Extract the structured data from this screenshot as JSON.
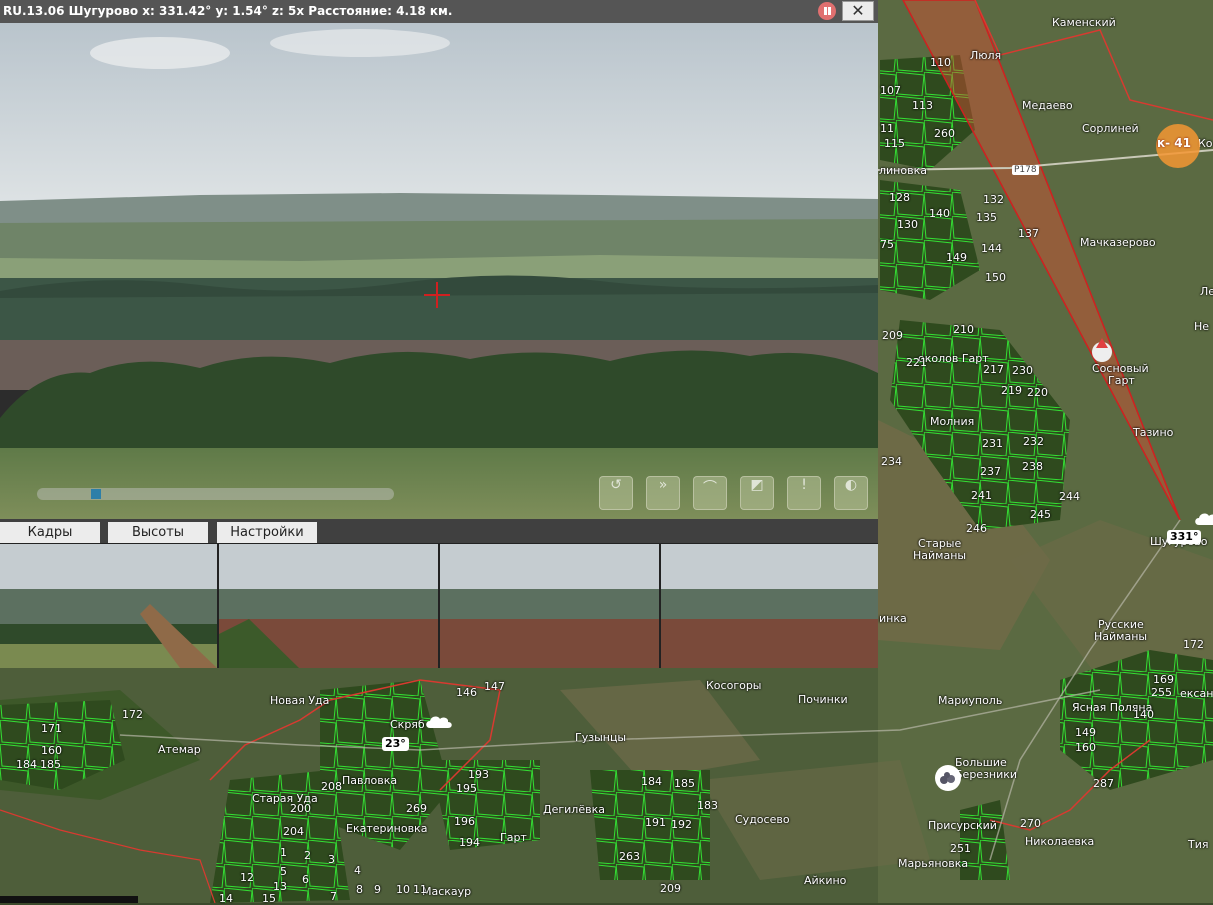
{
  "window": {
    "title": "RU.13.06 Шугурово x: 331.42° y: 1.54° z: 5x Расстояние: 4.18 км.",
    "close_glyph": "✕"
  },
  "tabs": [
    {
      "label": "Кадры"
    },
    {
      "label": "Высоты"
    },
    {
      "label": "Настройки"
    }
  ],
  "controls": [
    {
      "icon": "rotate-left-icon",
      "glyph": "↺"
    },
    {
      "icon": "fast-forward-icon",
      "glyph": "»"
    },
    {
      "icon": "wiper-icon",
      "glyph": "⌒"
    },
    {
      "icon": "window-icon",
      "glyph": "◩"
    },
    {
      "icon": "alert-icon",
      "glyph": "!"
    },
    {
      "icon": "layers-icon",
      "glyph": "◐"
    }
  ],
  "timeline": {
    "position": 0.15
  },
  "map": {
    "places": [
      "Каменский",
      "Люля",
      "Медаево",
      "Сорлиней",
      "Мачказерово",
      "Сосновый",
      "Гарт",
      "Тазино",
      "Молния",
      "Старые",
      "Найманы",
      "Русские",
      "Найманы",
      "Мариуполь",
      "Большие",
      "Березники",
      "Ясная Поляна",
      "Присурский",
      "Николаевка",
      "Марьяновка",
      "Айкино",
      "Судосево",
      "Гузынцы",
      "Дегилёвка",
      "Гарт",
      "Екатериновка",
      "Павловка",
      "Старая Уда",
      "Атемар",
      "Новая Уда",
      "Скряб",
      "Косогоры",
      "Починки",
      "Маскаур",
      "Шугурово",
      "Тия",
      "Не",
      "Ле",
      "линовка",
      "Ко",
      "околов Гарт",
      "инка",
      "ександ"
    ],
    "road_label": "Р178",
    "fire_label": "к- 41",
    "heading_label": "331°",
    "temperature": "23°",
    "plot_numbers": [
      "110",
      "107",
      "113",
      "11",
      "115",
      "260",
      "128",
      "140",
      "130",
      "132",
      "135",
      "137",
      "144",
      "149",
      "150",
      "75",
      "209",
      "210",
      "221",
      "217",
      "230",
      "219",
      "220",
      "231",
      "232",
      "234",
      "237",
      "238",
      "241",
      "244",
      "245",
      "246",
      "171",
      "172",
      "160",
      "184",
      "185",
      "146",
      "147",
      "193",
      "195",
      "208",
      "200",
      "204",
      "269",
      "196",
      "194",
      "184",
      "185",
      "183",
      "191",
      "192",
      "263",
      "209",
      "1",
      "2",
      "3",
      "4",
      "5",
      "6",
      "12",
      "13",
      "8",
      "9",
      "10",
      "11",
      "14",
      "15",
      "7",
      "172",
      "169",
      "255",
      "140",
      "149",
      "160",
      "287",
      "270",
      "251"
    ]
  },
  "colors": {
    "accent_red": "#d02020",
    "plot_green": "#2cf02c",
    "border_red": "#d83a30",
    "fire_orange": "#f59632",
    "pin_orange": "#f0902a"
  }
}
